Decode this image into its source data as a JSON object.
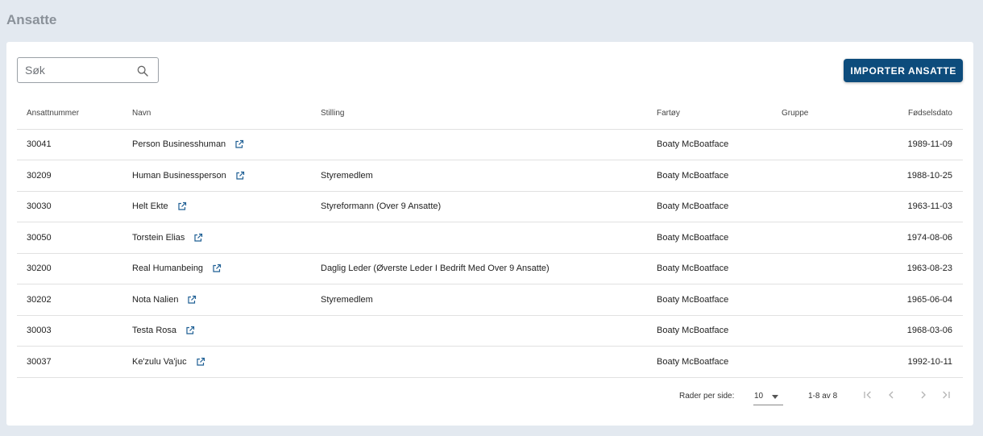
{
  "page": {
    "title": "Ansatte"
  },
  "toolbar": {
    "search_placeholder": "Søk",
    "import_label": "IMPORTER ANSATTE"
  },
  "table": {
    "headers": {
      "number": "Ansattnummer",
      "name": "Navn",
      "position": "Stilling",
      "vessel": "Fartøy",
      "group": "Gruppe",
      "dob": "Fødselsdato"
    },
    "rows": [
      {
        "number": "30041",
        "name": "Person Businesshuman",
        "position": "",
        "vessel": "Boaty McBoatface",
        "group": "",
        "dob": "1989-11-09"
      },
      {
        "number": "30209",
        "name": "Human Businessperson",
        "position": "Styremedlem",
        "vessel": "Boaty McBoatface",
        "group": "",
        "dob": "1988-10-25"
      },
      {
        "number": "30030",
        "name": "Helt Ekte",
        "position": "Styreformann (Over 9 Ansatte)",
        "vessel": "Boaty McBoatface",
        "group": "",
        "dob": "1963-11-03"
      },
      {
        "number": "30050",
        "name": "Torstein Elias",
        "position": "",
        "vessel": "Boaty McBoatface",
        "group": "",
        "dob": "1974-08-06"
      },
      {
        "number": "30200",
        "name": "Real Humanbeing",
        "position": "Daglig Leder (Øverste Leder I Bedrift Med Over 9 Ansatte)",
        "vessel": "Boaty McBoatface",
        "group": "",
        "dob": "1963-08-23"
      },
      {
        "number": "30202",
        "name": "Nota Nalien",
        "position": "Styremedlem",
        "vessel": "Boaty McBoatface",
        "group": "",
        "dob": "1965-06-04"
      },
      {
        "number": "30003",
        "name": "Testa Rosa",
        "position": "",
        "vessel": "Boaty McBoatface",
        "group": "",
        "dob": "1968-03-06"
      },
      {
        "number": "30037",
        "name": "Ke'zulu Va'juc",
        "position": "",
        "vessel": "Boaty McBoatface",
        "group": "",
        "dob": "1992-10-11"
      }
    ]
  },
  "pagination": {
    "rows_per_page_label": "Rader per side:",
    "rows_per_page_value": "10",
    "range_text": "1-8 av 8"
  },
  "icons": {
    "search": "search-icon",
    "row_link": "open-in-new-icon",
    "first": "first-page-icon",
    "prev": "chevron-left-icon",
    "next": "chevron-right-icon",
    "last": "last-page-icon"
  },
  "colors": {
    "primary": "#0d4c7c",
    "link_icon": "#1f5f94",
    "background": "#e3e9f0"
  }
}
